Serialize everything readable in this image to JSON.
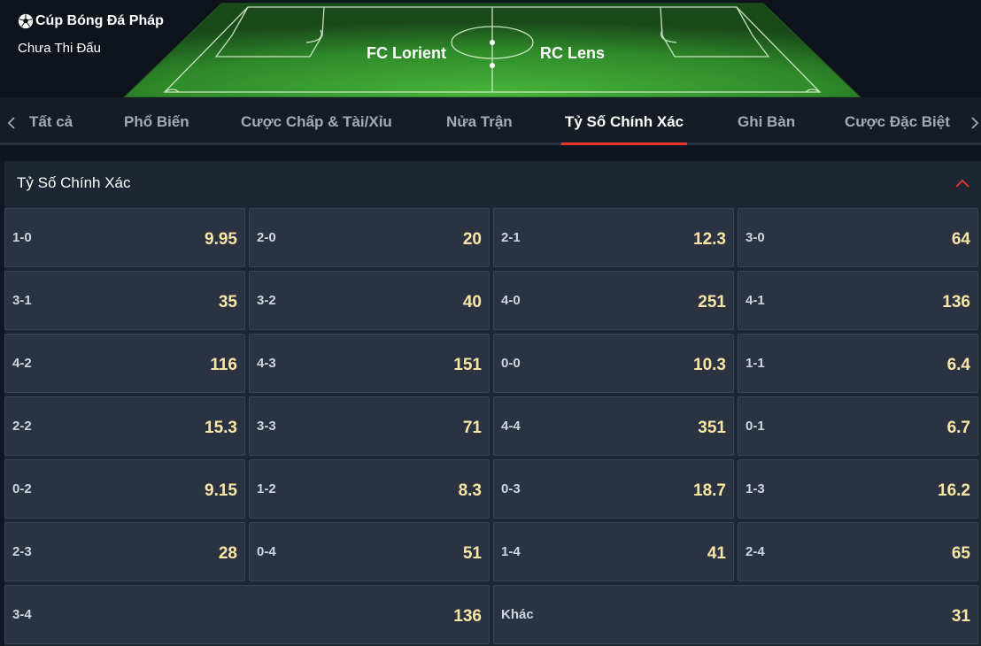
{
  "header": {
    "league": "Cúp Bóng Đá Pháp",
    "status": "Chưa Thi Đấu",
    "home_team": "FC Lorient",
    "away_team": "RC Lens",
    "icon": "soccer-ball-icon"
  },
  "tabs": [
    {
      "label": "Tất cả",
      "active": false
    },
    {
      "label": "Phổ Biến",
      "active": false
    },
    {
      "label": "Cược Chấp & Tài/Xỉu",
      "active": false
    },
    {
      "label": "Nửa Trận",
      "active": false
    },
    {
      "label": "Tỷ Số Chính Xác",
      "active": true
    },
    {
      "label": "Ghi Bàn",
      "active": false
    },
    {
      "label": "Cược Đặc Biệt",
      "active": false
    }
  ],
  "section": {
    "title": "Tỷ Số Chính Xác",
    "collapse_icon": "chevron-up-icon",
    "accent": "#e8362c"
  },
  "colors": {
    "odds": "#f8e6a6",
    "cell_bg": "#2b3342",
    "active_tab_underline": "#e8362c"
  },
  "scores": [
    {
      "label": "1-0",
      "odds": "9.95"
    },
    {
      "label": "2-0",
      "odds": "20"
    },
    {
      "label": "2-1",
      "odds": "12.3"
    },
    {
      "label": "3-0",
      "odds": "64"
    },
    {
      "label": "3-1",
      "odds": "35"
    },
    {
      "label": "3-2",
      "odds": "40"
    },
    {
      "label": "4-0",
      "odds": "251"
    },
    {
      "label": "4-1",
      "odds": "136"
    },
    {
      "label": "4-2",
      "odds": "116"
    },
    {
      "label": "4-3",
      "odds": "151"
    },
    {
      "label": "0-0",
      "odds": "10.3"
    },
    {
      "label": "1-1",
      "odds": "6.4"
    },
    {
      "label": "2-2",
      "odds": "15.3"
    },
    {
      "label": "3-3",
      "odds": "71"
    },
    {
      "label": "4-4",
      "odds": "351"
    },
    {
      "label": "0-1",
      "odds": "6.7"
    },
    {
      "label": "0-2",
      "odds": "9.15"
    },
    {
      "label": "1-2",
      "odds": "8.3"
    },
    {
      "label": "0-3",
      "odds": "18.7"
    },
    {
      "label": "1-3",
      "odds": "16.2"
    },
    {
      "label": "2-3",
      "odds": "28"
    },
    {
      "label": "0-4",
      "odds": "51"
    },
    {
      "label": "1-4",
      "odds": "41"
    },
    {
      "label": "2-4",
      "odds": "65"
    },
    {
      "label": "3-4",
      "odds": "136",
      "wide": true
    },
    {
      "label": "Khác",
      "odds": "31",
      "wide": true
    }
  ]
}
